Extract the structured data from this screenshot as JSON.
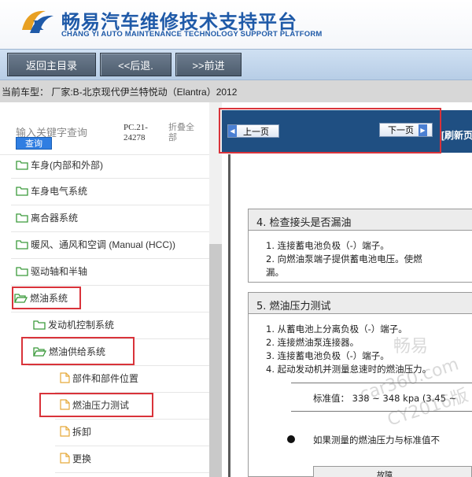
{
  "header": {
    "title": "畅易汽车维修技术支持平台",
    "subtitle": "CHANG YI AUTO MAINTENANCE TECHNOLOGY SUPPORT PLATFORM",
    "brand_color": "#1f5aa8"
  },
  "nav": {
    "home_label": "返回主目录",
    "back_label": "<<后退.",
    "forward_label": ">>前进"
  },
  "vehicle": {
    "text": "当前车型：  厂家:B-北京现代伊兰特悦动（Elantra）2012"
  },
  "sidebar": {
    "search_placeholder": "输入关键字查询",
    "search_button": "查询",
    "code": "PC.21-24278",
    "collapse_label": "折叠全部",
    "items": [
      {
        "label": "车身(内部和外部)",
        "icon": "folder-icon"
      },
      {
        "label": "车身电气系统",
        "icon": "folder-icon"
      },
      {
        "label": "离合器系统",
        "icon": "folder-icon"
      },
      {
        "label": "暖风、通风和空调 (Manual (HCC))",
        "icon": "folder-icon"
      },
      {
        "label": "驱动轴和半轴",
        "icon": "folder-icon"
      },
      {
        "label": "燃油系统",
        "icon": "folder-open-icon"
      },
      {
        "label": "发动机控制系统",
        "icon": "folder-icon"
      },
      {
        "label": "燃油供给系统",
        "icon": "folder-open-icon"
      },
      {
        "label": "部件和部件位置",
        "icon": "document-icon"
      },
      {
        "label": "燃油压力测试",
        "icon": "document-icon"
      },
      {
        "label": "拆卸",
        "icon": "document-icon"
      },
      {
        "label": "更换",
        "icon": "document-icon"
      }
    ]
  },
  "document": {
    "prev_label": "上一页",
    "next_label": "下一页",
    "refresh_label": "[刷新页面]",
    "section4_heading": "4. 检查接头是否漏油",
    "section4_lines": [
      "1.  连接蓄电池负极（-）端子。",
      "2.  向燃油泵端子提供蓄电池电压。使燃",
      "    漏。"
    ],
    "section5_heading": "5. 燃油压力测试",
    "section5_lines": [
      "1.  从蓄电池上分离负极（-）端子。",
      "2.  连接燃油泵连接器。",
      "3.  连接蓄电池负极（-）端子。",
      "4.  起动发动机并测量怠速时的燃油压力。"
    ],
    "standard_value": "标准值：  338 ~ 348 kpa (3.45 ~",
    "bullet_text": "如果测量的燃油压力与标准值不",
    "watermark_1": "畅易",
    "watermark_2": "car360.com",
    "watermark_3": "CY2016版",
    "table_fragment": "故障"
  }
}
